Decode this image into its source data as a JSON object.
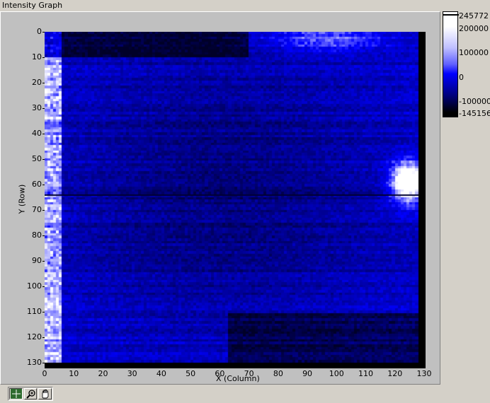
{
  "graph": {
    "caption": "Intensity Graph",
    "x_axis_title": "X (Column)",
    "y_axis_title": "Y (Row)",
    "x_ticks": [
      "0",
      "10",
      "20",
      "30",
      "40",
      "50",
      "60",
      "70",
      "80",
      "90",
      "100",
      "110",
      "120",
      "130"
    ],
    "y_ticks": [
      "0",
      "10",
      "20",
      "30",
      "40",
      "50",
      "60",
      "70",
      "80",
      "90",
      "100",
      "110",
      "120",
      "130"
    ],
    "x_range": [
      0,
      130
    ],
    "y_range": [
      0,
      130
    ]
  },
  "color_scale": {
    "labels": [
      "245772",
      "200000",
      "100000",
      "0",
      "-100000",
      "-145156"
    ],
    "colors": {
      "high": "#ffffff",
      "mid": "#0000ff",
      "low": "#000000"
    }
  },
  "palette": {
    "tools": [
      {
        "name": "cursor-tool",
        "icon": "crosshair-icon"
      },
      {
        "name": "zoom-tool",
        "icon": "zoom-icon"
      },
      {
        "name": "pan-tool",
        "icon": "hand-icon"
      }
    ]
  }
}
